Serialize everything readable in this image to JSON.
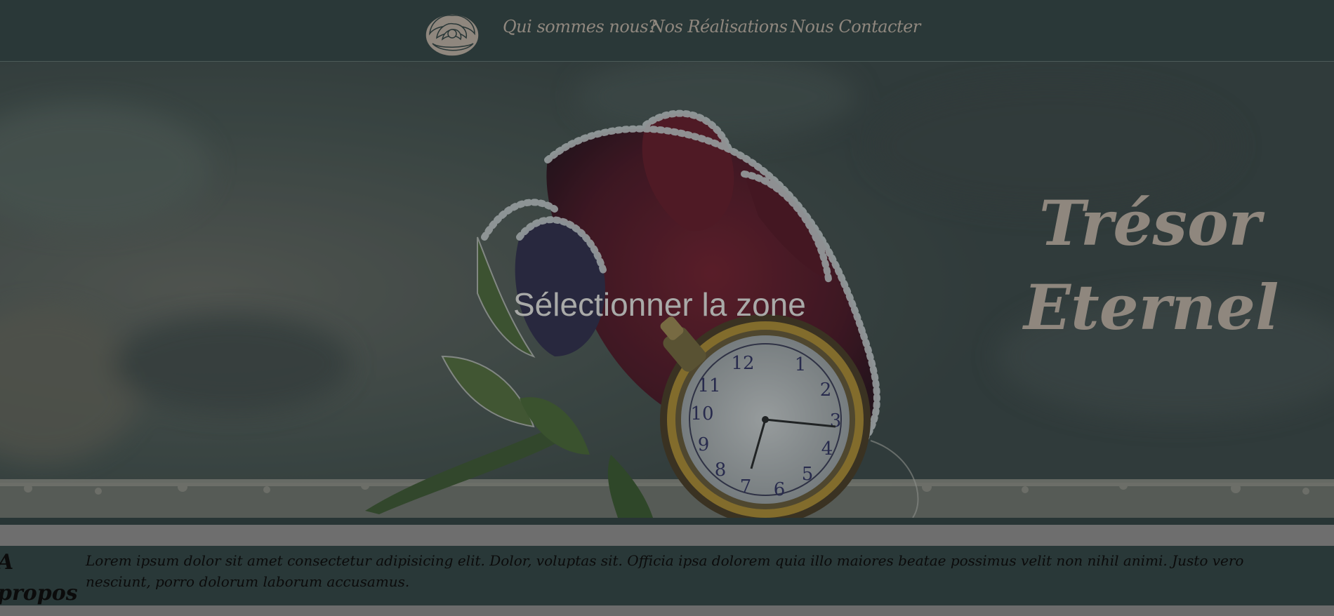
{
  "nav": {
    "logo_icon": "rose-icon",
    "links": [
      {
        "label": "Qui sommes nous?"
      },
      {
        "label": "Nos Réalisations"
      },
      {
        "label": "Nous Contacter"
      }
    ]
  },
  "hero": {
    "title_line1": "Trésor",
    "title_line2": "Eternel",
    "overlay_text": "Sélectionner la zone",
    "image_icon": "frosted-rose-pocket-watch-image"
  },
  "about": {
    "title": "A propos",
    "text": "Lorem ipsum dolor sit amet consectetur adipisicing elit. Dolor, voluptas sit. Officia ipsa dolorem quia illo maiores beatae possimus velit non nihil animi. Justo vero nesciunt, porro dolorum laborum accusamus."
  },
  "colors": {
    "nav_bg": "#2a3838",
    "accent_text": "#8f877e",
    "about_bg": "#293838",
    "strip": "#6e6e6e"
  }
}
